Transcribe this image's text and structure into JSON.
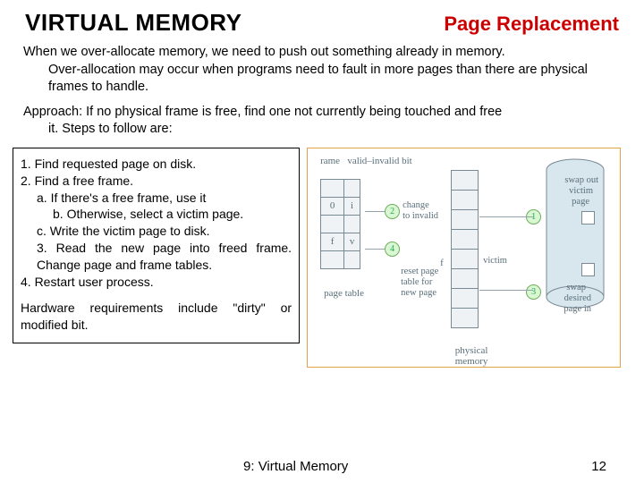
{
  "header": {
    "main": "VIRTUAL MEMORY",
    "sub": "Page Replacement"
  },
  "para1a": "When we over-allocate memory, we need to push out something already in memory.",
  "para1b": "Over-allocation may occur when programs need to fault in more pages than there are physical frames to handle.",
  "para2a": "Approach: If no physical frame is free, find one not currently being touched and free",
  "para2b": "it. Steps to follow are:",
  "steps": {
    "s1": "1. Find requested page on disk.",
    "s2": "2. Find a free frame.",
    "s2a": "a. If there's a free frame, use it",
    "s2b": "b. Otherwise, select a victim page.",
    "s2c": "c. Write the victim page to disk.",
    "s3": "3. Read the new page into freed frame.  Change page and frame tables.",
    "s4": "4. Restart user process.",
    "hw": "Hardware requirements include \"dirty\" or modified bit."
  },
  "diagram": {
    "head_frame": "rame",
    "head_bit": "valid–invalid bit",
    "pt_rows": {
      "r2f": "0",
      "r2b": "i",
      "r4f": "f",
      "r4b": "v"
    },
    "pt_label": "page table",
    "pm_label": "physical memory",
    "f_label": "f",
    "victim_label": "victim",
    "c1": "1",
    "c2": "2",
    "c3": "3",
    "c4": "4",
    "l_change": "change",
    "l_toinvalid": "to invalid",
    "l_reset1": "reset page",
    "l_reset2": "table for",
    "l_reset3": "new page",
    "l_swapout1": "swap out",
    "l_swapout2": "victim",
    "l_swapout3": "page",
    "l_swapin1": "swap",
    "l_swapin2": "desired",
    "l_swapin3": "page in"
  },
  "footer": {
    "title": "9: Virtual Memory",
    "page": "12"
  }
}
